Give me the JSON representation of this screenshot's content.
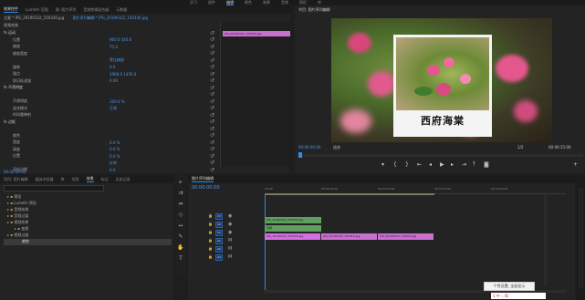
{
  "header": {
    "tabs": [
      "学习",
      "组件",
      "编辑",
      "颜色",
      "效果",
      "音频",
      "图形",
      "库"
    ],
    "active_tab_index": 2
  },
  "effect_controls": {
    "tabs": [
      "效果控件",
      "Lumetri 范围",
      "源: 图片序列",
      "音频剪辑混合器",
      "元数据"
    ],
    "active_tab_index": 0,
    "clip_path": "主要 * IPG_20190322_150330.jpg",
    "sequence_link": "图片序列编辑 * IPG_20190322_150330.jpg",
    "section_label": "视频效果",
    "clip_tag": "IPG_20190322_150330.jpg",
    "rows": [
      {
        "label": "fx 运动",
        "value": ""
      },
      {
        "label": "位置",
        "value": "960.0  540.0"
      },
      {
        "label": "缩放",
        "value": "75.0"
      },
      {
        "label": "缩放宽度",
        "value": ""
      },
      {
        "label": "",
        "value": "等比缩放"
      },
      {
        "label": "旋转",
        "value": "0.0"
      },
      {
        "label": "锚点",
        "value": "1968.0  1476.0"
      },
      {
        "label": "防闪烁滤镜",
        "value": "0.00"
      },
      {
        "label": "fx 不透明度",
        "value": ""
      },
      {
        "label": "",
        "value": ""
      },
      {
        "label": "不透明度",
        "value": "100.0 %"
      },
      {
        "label": "混合模式",
        "value": "正常"
      },
      {
        "label": "时间重映射",
        "value": ""
      },
      {
        "label": "fx 边框",
        "value": ""
      },
      {
        "label": "",
        "value": ""
      },
      {
        "label": "颜色",
        "value": ""
      },
      {
        "label": "宽度",
        "value": "0.0 %"
      },
      {
        "label": "高度",
        "value": "0.0 %"
      },
      {
        "label": "位置",
        "value": "0.0 %"
      },
      {
        "label": "",
        "value": "反转"
      },
      {
        "label": "羽化边缘",
        "value": "0.0"
      }
    ],
    "timecode": "00:00:00:00"
  },
  "program": {
    "title": "节目: 图片序列编辑",
    "caption_text": "西府海棠",
    "timecode": "00:00:00:00",
    "fit_label": "适合",
    "quality_label": "1/2",
    "duration": "00:00:15:00"
  },
  "project": {
    "tabs": [
      "项目: 图片编辑",
      "媒体浏览器",
      "库",
      "信息",
      "效果",
      "标记",
      "历史记录"
    ],
    "active_tab_index": 4,
    "search_placeholder": "",
    "tree": [
      "预设",
      "Lumetri 预设",
      "音频效果",
      "音频过渡",
      "视频效果",
      "变换",
      "视频过渡"
    ],
    "selected_item": "裁剪"
  },
  "timeline": {
    "tab": "图片序列编辑",
    "timecode": "00:00:00:00",
    "ruler": [
      "00:00",
      "00:00:05:00",
      "00:00:10:00",
      "00:00:15:00",
      "00:00:20:00"
    ],
    "tracks": [
      "V3",
      "V2",
      "V1",
      "A1",
      "A2",
      "A3"
    ],
    "clips_v3": "IPG_20190322_150330.jpg",
    "clips_v2": "字幕",
    "clips_v1": [
      "IPG_20190322_150330.jpg",
      "IPG_20190322_151016.jpg",
      "IPG_20190322_154643.jpg"
    ]
  },
  "notice": {
    "text": "个性设置, 全部显示",
    "ime": "S 中 ·, 简 "
  },
  "colors": {
    "accent": "#2d8ceb",
    "clip": "#c86fcf",
    "clip_green": "#5e9e5f",
    "panel": "#232323"
  }
}
